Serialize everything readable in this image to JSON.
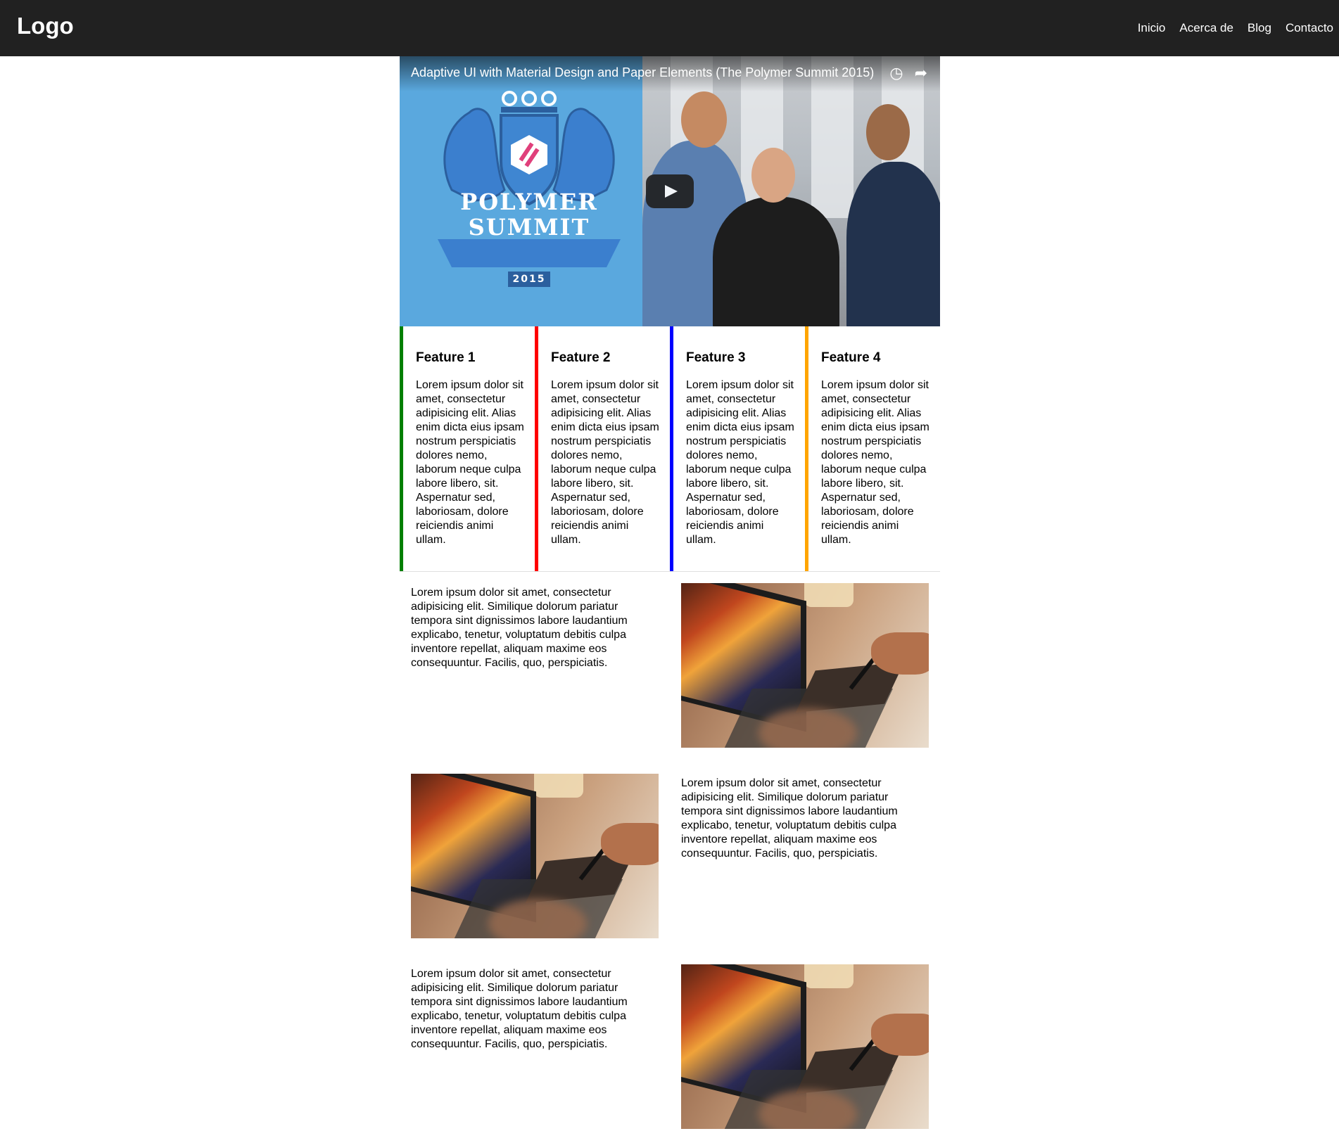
{
  "header": {
    "logo": "Logo",
    "nav": [
      "Inicio",
      "Acerca de",
      "Blog",
      "Contacto"
    ]
  },
  "video": {
    "title": "Adaptive UI with Material Design and Paper Elements (The Polymer Summit 2015)",
    "crest_line1": "POLYMER",
    "crest_line2": "SUMMIT",
    "crest_year": "2015"
  },
  "features": [
    {
      "title": "Feature 1",
      "color": "#008000",
      "text": "Lorem ipsum dolor sit amet, consectetur adipisicing elit. Alias enim dicta eius ipsam nostrum perspiciatis dolores nemo, laborum neque culpa labore libero, sit. Aspernatur sed, laboriosam, dolore reiciendis animi ullam."
    },
    {
      "title": "Feature 2",
      "color": "#ff0000",
      "text": "Lorem ipsum dolor sit amet, consectetur adipisicing elit. Alias enim dicta eius ipsam nostrum perspiciatis dolores nemo, laborum neque culpa labore libero, sit. Aspernatur sed, laboriosam, dolore reiciendis animi ullam."
    },
    {
      "title": "Feature 3",
      "color": "#0000ff",
      "text": "Lorem ipsum dolor sit amet, consectetur adipisicing elit. Alias enim dicta eius ipsam nostrum perspiciatis dolores nemo, laborum neque culpa labore libero, sit. Aspernatur sed, laboriosam, dolore reiciendis animi ullam."
    },
    {
      "title": "Feature 4",
      "color": "#ffa500",
      "text": "Lorem ipsum dolor sit amet, consectetur adipisicing elit. Alias enim dicta eius ipsam nostrum perspiciatis dolores nemo, laborum neque culpa labore libero, sit. Aspernatur sed, laboriosam, dolore reiciendis animi ullam."
    }
  ],
  "rows": [
    {
      "text": "Lorem ipsum dolor sit amet, consectetur adipisicing elit. Similique dolorum pariatur tempora sint dignissimos labore laudantium explicabo, tenetur, voluptatum debitis culpa inventore repellat, aliquam maxime eos consequuntur. Facilis, quo, perspiciatis."
    },
    {
      "text": "Lorem ipsum dolor sit amet, consectetur adipisicing elit. Similique dolorum pariatur tempora sint dignissimos labore laudantium explicabo, tenetur, voluptatum debitis culpa inventore repellat, aliquam maxime eos consequuntur. Facilis, quo, perspiciatis."
    },
    {
      "text": "Lorem ipsum dolor sit amet, consectetur adipisicing elit. Similique dolorum pariatur tempora sint dignissimos labore laudantium explicabo, tenetur, voluptatum debitis culpa inventore repellat, aliquam maxime eos consequuntur. Facilis, quo, perspiciatis."
    }
  ]
}
